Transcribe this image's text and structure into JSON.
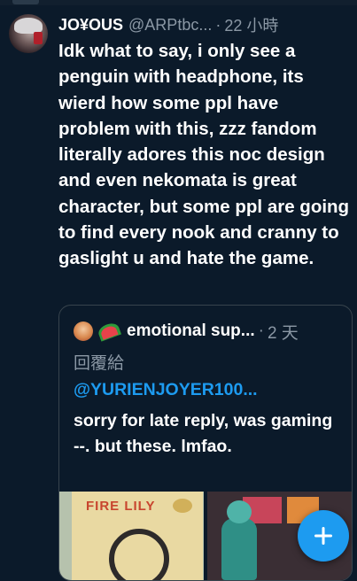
{
  "tweet": {
    "author_name": "JO¥OUS",
    "author_handle": "@ARPtbc...",
    "separator": "·",
    "time": "22 小時",
    "text": "Idk what to say, i only see a penguin with headphone, its wierd how some ppl have problem with this, zzz fandom literally adores this noc design and even nekomata is great character, but some ppl are going to find every nook and cranny to gaslight u and hate the game."
  },
  "quoted": {
    "author_name": "emotional sup...",
    "separator": "·",
    "time": "2 天",
    "reply_label": "回覆給",
    "mention": "@YURIENJOYER100...",
    "text": "sorry for late reply,  was gaming --.  but these. lmfao.",
    "media": [
      {
        "kind": "image",
        "sign_text": "FIRE LILY"
      },
      {
        "kind": "image"
      }
    ]
  },
  "icons": {
    "author_avatar": "avatar",
    "quoted_avatar": "avatar",
    "quoted_emoji": "watermelon-icon",
    "fab": "plus-icon"
  },
  "colors": {
    "background": "#0b1a2a",
    "text": "#ffffff",
    "muted": "#8b98a5",
    "accent": "#1d9bf0",
    "border": "#38444d"
  }
}
